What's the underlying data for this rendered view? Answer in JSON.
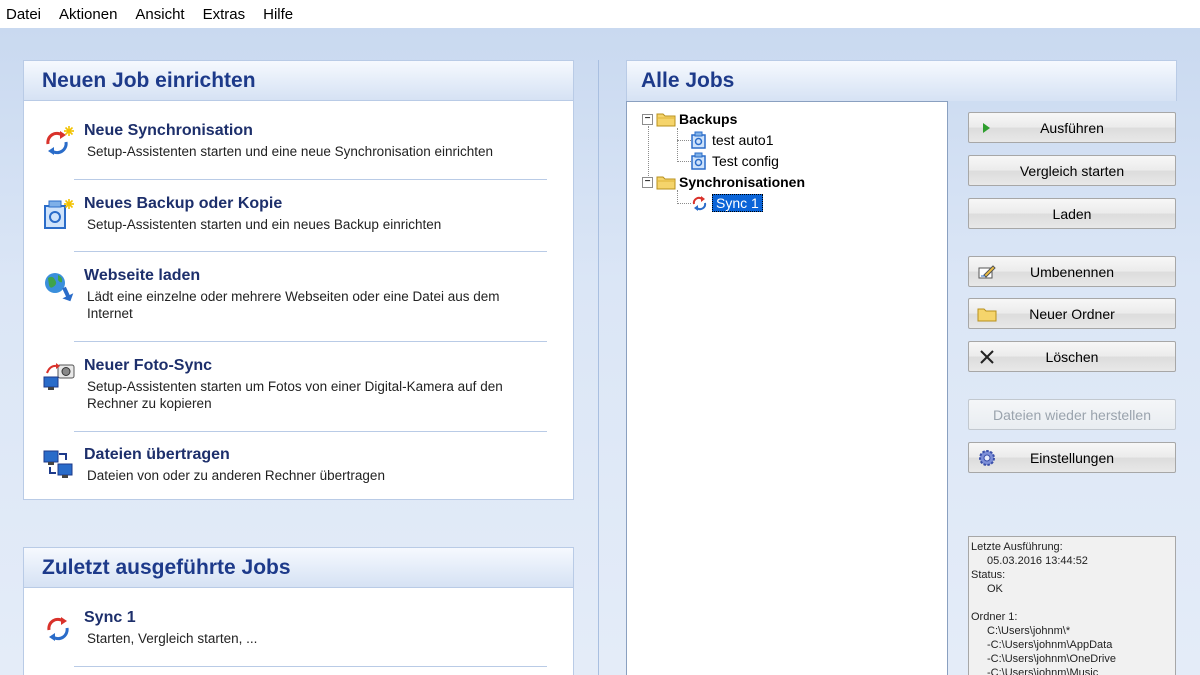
{
  "menu": [
    "Datei",
    "Aktionen",
    "Ansicht",
    "Extras",
    "Hilfe"
  ],
  "new_job": {
    "title": "Neuen Job einrichten",
    "items": [
      {
        "title": "Neue Synchronisation",
        "desc": "Setup-Assistenten starten und eine neue Synchronisation einrichten",
        "icon": "sync-new-icon"
      },
      {
        "title": "Neues Backup oder Kopie",
        "desc": "Setup-Assistenten starten und ein neues Backup einrichten",
        "icon": "backup-new-icon"
      },
      {
        "title": "Webseite laden",
        "desc": "Lädt eine einzelne oder mehrere Webseiten oder eine Datei aus dem Internet",
        "icon": "globe-download-icon"
      },
      {
        "title": "Neuer Foto-Sync",
        "desc": "Setup-Assistenten starten um Fotos von einer Digital-Kamera auf den Rechner zu kopieren",
        "icon": "camera-sync-icon"
      },
      {
        "title": "Dateien übertragen",
        "desc": "Dateien von oder zu anderen Rechner übertragen",
        "icon": "computers-transfer-icon"
      }
    ]
  },
  "recent": {
    "title": "Zuletzt ausgeführte Jobs",
    "items": [
      {
        "title": "Sync 1",
        "desc": "Starten, Vergleich starten, ...",
        "icon": "sync-icon"
      }
    ]
  },
  "all_jobs": {
    "title": "Alle Jobs",
    "tree": {
      "backups": {
        "label": "Backups",
        "children": [
          "test auto1",
          "Test config"
        ]
      },
      "syncs": {
        "label": "Synchronisationen",
        "children": [
          "Sync 1"
        ]
      }
    }
  },
  "buttons": {
    "run": "Ausführen",
    "compare": "Vergleich starten",
    "load": "Laden",
    "rename": "Umbenennen",
    "new_folder": "Neuer Ordner",
    "delete": "Löschen",
    "restore": "Dateien wieder herstellen",
    "settings": "Einstellungen"
  },
  "info": {
    "last_run_label": "Letzte Ausführung:",
    "last_run_value": "05.03.2016 13:44:52",
    "status_label": "Status:",
    "status_value": "OK",
    "folder_label": "Ordner 1:",
    "folder_lines": [
      "C:\\Users\\johnm\\*",
      "-C:\\Users\\johnm\\AppData",
      "-C:\\Users\\johnm\\OneDrive",
      "-C:\\Users\\johnm\\Music"
    ]
  },
  "colors": {
    "title_blue": "#1d3a8a",
    "selection": "#0a64d8",
    "sync_red": "#d9322b",
    "sync_blue": "#2a6cc9"
  }
}
